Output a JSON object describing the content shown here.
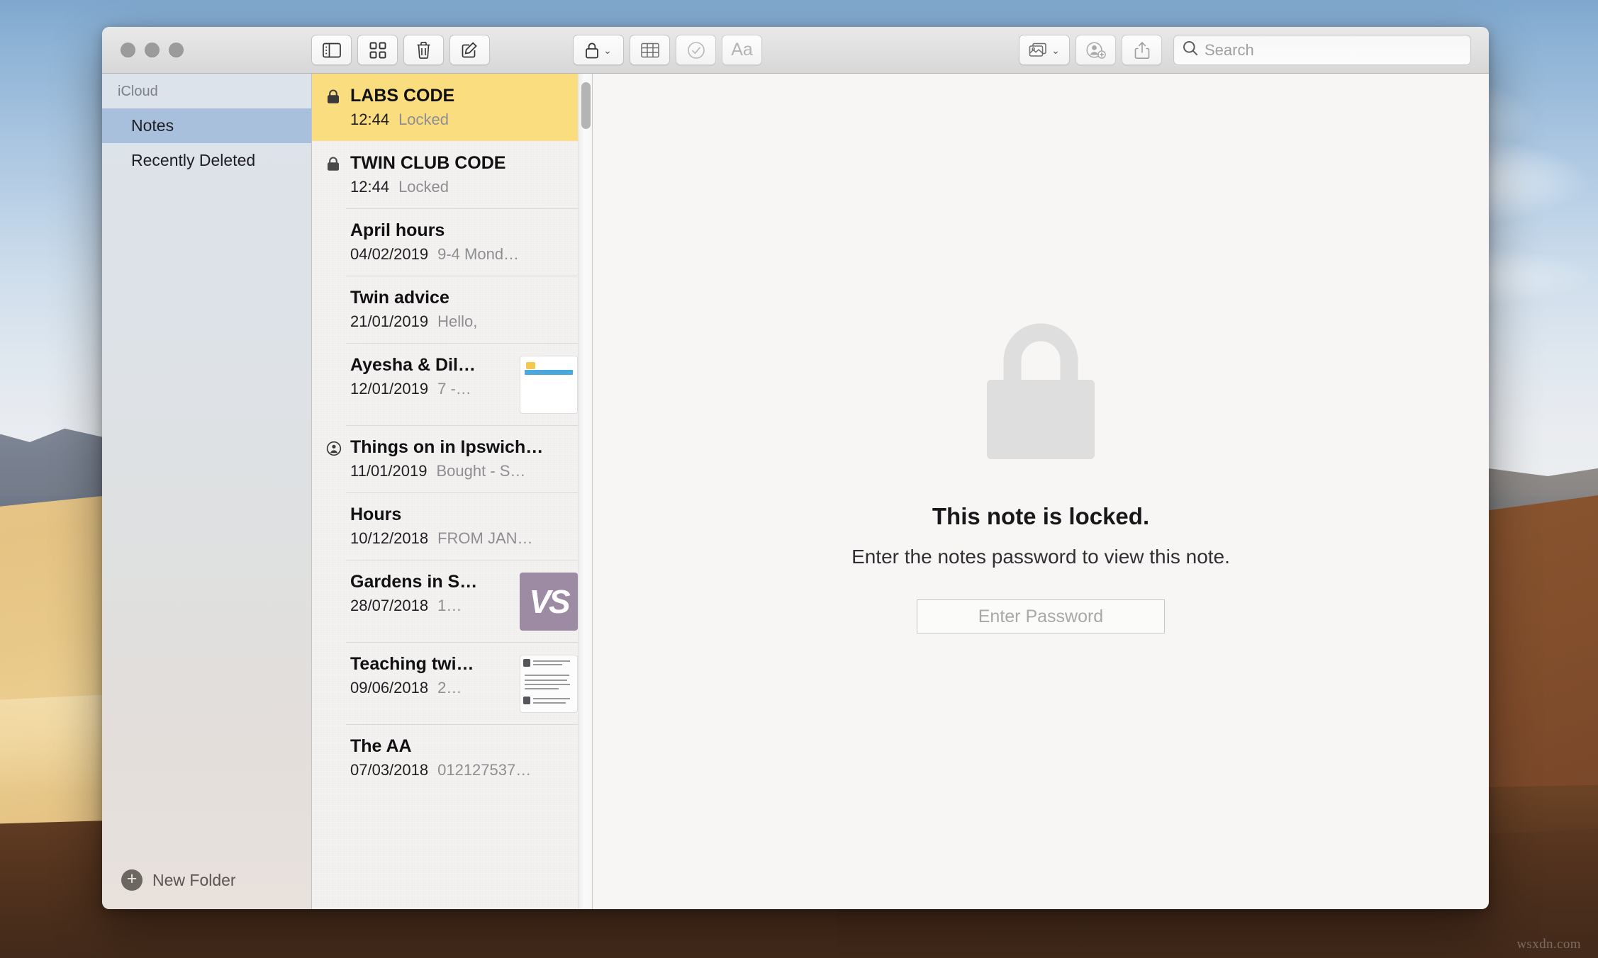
{
  "window": {
    "traffic_lights": [
      "close",
      "minimize",
      "zoom"
    ]
  },
  "toolbar": {
    "sidebar_toggle": "sidebar-toggle-icon",
    "gallery_view": "gallery-view-icon",
    "delete": "trash-icon",
    "compose": "compose-icon",
    "lock": "lock-icon",
    "table": "table-icon",
    "checklist": "checklist-icon",
    "format": "Aa",
    "media": "media-icon",
    "add_people": "add-person-icon",
    "share": "share-icon"
  },
  "search": {
    "placeholder": "Search",
    "value": ""
  },
  "sidebar": {
    "section_label": "iCloud",
    "items": [
      {
        "label": "Notes",
        "selected": true
      },
      {
        "label": "Recently Deleted",
        "selected": false
      }
    ],
    "new_folder_label": "New Folder"
  },
  "notes": [
    {
      "title": "LABS CODE",
      "date": "12:44",
      "snippet": "Locked",
      "icon": "lock",
      "thumb": "none",
      "selected": true
    },
    {
      "title": "TWIN CLUB CODE",
      "date": "12:44",
      "snippet": "Locked",
      "icon": "lock",
      "thumb": "none",
      "selected": false
    },
    {
      "title": "April hours",
      "date": "04/02/2019",
      "snippet": "9-4 Mond…",
      "icon": "none",
      "thumb": "none",
      "selected": false
    },
    {
      "title": "Twin advice",
      "date": "21/01/2019",
      "snippet": "Hello,",
      "icon": "none",
      "thumb": "none",
      "selected": false
    },
    {
      "title": "Ayesha & Dil…",
      "date": "12/01/2019",
      "snippet": "7 -…",
      "icon": "none",
      "thumb": "doc1",
      "selected": false
    },
    {
      "title": "Things on in Ipswich…",
      "date": "11/01/2019",
      "snippet": "Bought - S…",
      "icon": "shared",
      "thumb": "none",
      "selected": false
    },
    {
      "title": "Hours",
      "date": "10/12/2018",
      "snippet": "FROM JAN…",
      "icon": "none",
      "thumb": "none",
      "selected": false
    },
    {
      "title": "Gardens in S…",
      "date": "28/07/2018",
      "snippet": "1…",
      "icon": "none",
      "thumb": "vs",
      "selected": false
    },
    {
      "title": "Teaching twi…",
      "date": "09/06/2018",
      "snippet": "2…",
      "icon": "none",
      "thumb": "doc2",
      "selected": false
    },
    {
      "title": "The AA",
      "date": "07/03/2018",
      "snippet": "012127537…",
      "icon": "none",
      "thumb": "none",
      "selected": false
    }
  ],
  "editor": {
    "locked_title": "This note is locked.",
    "locked_subtitle": "Enter the notes password to view this note.",
    "password_placeholder": "Enter Password",
    "password_value": "",
    "lock_icon": "lock-large-icon"
  },
  "desktop": {
    "watermark": "wsxdn.com"
  },
  "colors": {
    "selected_note": "#f9dd7f",
    "sidebar_selection": "#a9c0dd",
    "vs_thumb": "#9c8ba3"
  }
}
